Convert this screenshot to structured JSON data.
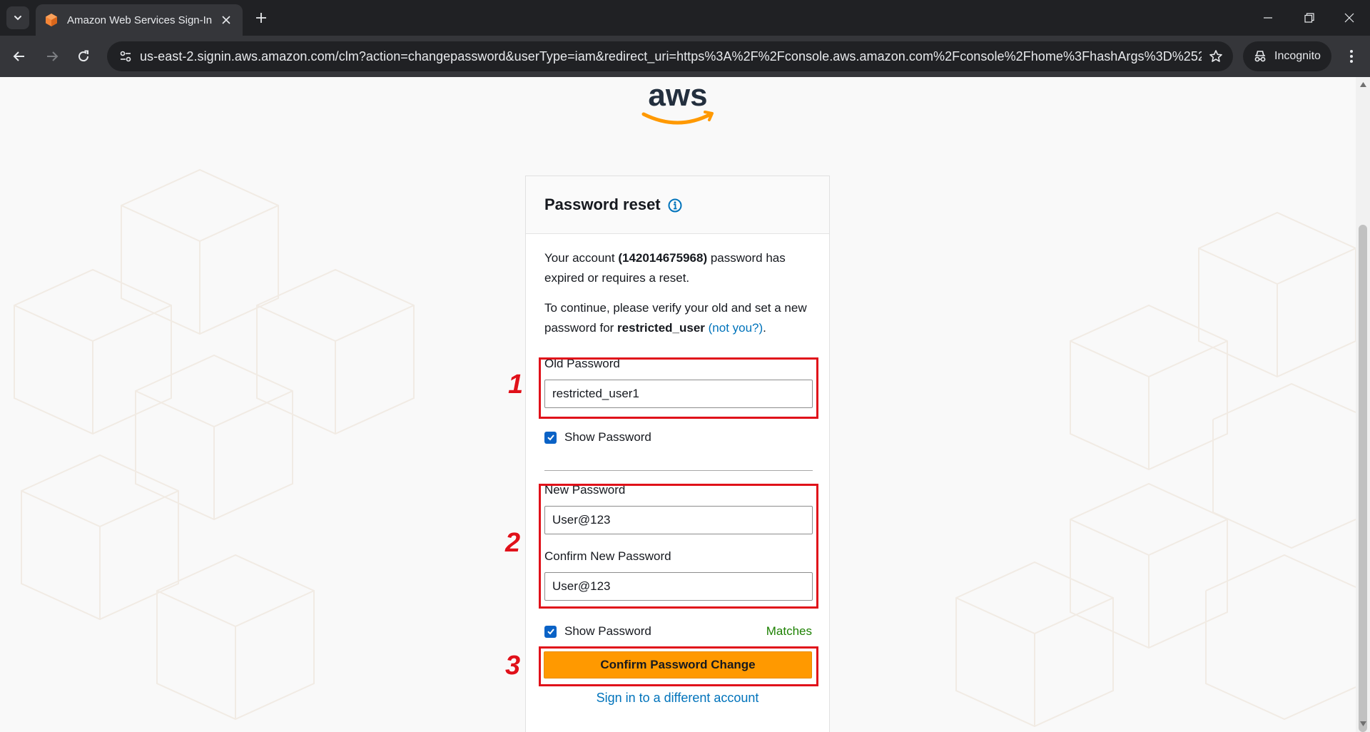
{
  "browser": {
    "tab_title": "Amazon Web Services Sign-In",
    "url": "us-east-2.signin.aws.amazon.com/clm?action=changepassword&userType=iam&redirect_uri=https%3A%2F%2Fconsole.aws.amazon.com%2Fconsole%2Fhome%3FhashArgs%3D%2523%26is...",
    "incognito_label": "Incognito"
  },
  "page": {
    "logo_text": "aws",
    "card": {
      "title": "Password reset",
      "intro_prefix": "Your account ",
      "account_id": "(142014675968)",
      "intro_suffix": " password has expired or requires a reset.",
      "continue_prefix": "To continue, please verify your old and set a new password for ",
      "username": "restricted_user",
      "not_you_link": "(not you?)",
      "continue_suffix": ".",
      "old_password_label": "Old Password",
      "old_password_value": "restricted_user1",
      "show_password_label": "Show Password",
      "new_password_label": "New Password",
      "new_password_value": "User@123",
      "confirm_password_label": "Confirm New Password",
      "confirm_password_value": "User@123",
      "match_status": "Matches",
      "submit_label": "Confirm Password Change",
      "alt_link": "Sign in to a different account"
    }
  },
  "annotations": [
    "1",
    "2",
    "3"
  ],
  "colors": {
    "accent_orange": "#ff9900",
    "link_blue": "#0073bb",
    "annotation_red": "#e0111a",
    "match_green": "#1d8102"
  }
}
